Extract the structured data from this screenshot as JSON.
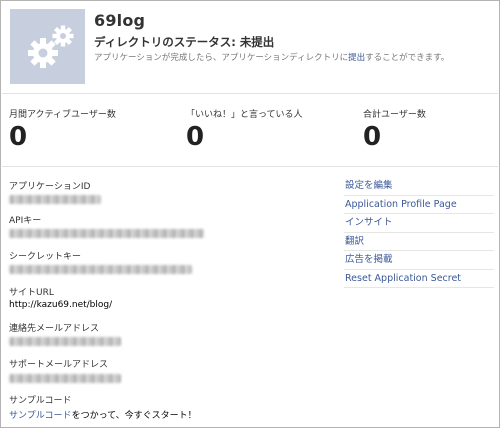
{
  "app": {
    "title": "69log",
    "status_label": "ディレクトリのステータス:",
    "status_value": "未提出",
    "hint_before": "アプリケーションが完成したら、アプリケーションディレクトリに",
    "hint_link": "提出",
    "hint_after": "することができます。",
    "icon": "gears-icon"
  },
  "stats": [
    {
      "label": "月間アクティブユーザー数",
      "value": "0"
    },
    {
      "label": "「いいね！」と言っている人",
      "value": "0"
    },
    {
      "label": "合計ユーザー数",
      "value": "0"
    }
  ],
  "details": {
    "app_id_label": "アプリケーションID",
    "api_key_label": "APIキー",
    "secret_label": "シークレットキー",
    "site_url_label": "サイトURL",
    "site_url_value": "http://kazu69.net/blog/",
    "contact_email_label": "連絡先メールアドレス",
    "support_email_label": "サポートメールアドレス",
    "sample_code_label": "サンプルコード",
    "sample_code_link": "サンプルコード",
    "sample_code_after": "をつかって、今すぐスタート！"
  },
  "menu": [
    {
      "label": "設定を編集"
    },
    {
      "label": "Application Profile Page"
    },
    {
      "label": "インサイト"
    },
    {
      "label": "翻訳"
    },
    {
      "label": "広告を掲載"
    },
    {
      "label": "Reset Application Secret"
    }
  ],
  "colors": {
    "link": "#3b5998",
    "icon_bg": "#c7cfde"
  }
}
